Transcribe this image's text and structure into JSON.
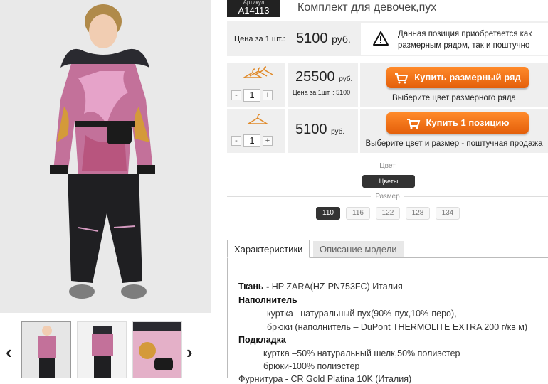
{
  "product": {
    "sku_caption": "Артикул",
    "sku": "A14113",
    "title": "Комплект для девочек,пух"
  },
  "price_row": {
    "label": "Цена за 1 шт.:",
    "value": "5100",
    "currency": "руб."
  },
  "notice": {
    "icon": "warning-icon",
    "text": "Данная позиция приобретается как размерным рядом, так и поштучно"
  },
  "buy_set": {
    "icon": "three-hangers-icon",
    "qty": "1",
    "minus": "-",
    "plus": "+",
    "price": "25500",
    "currency": "руб.",
    "unit_price_text": "Цена за 1шт. : 5100",
    "button_label": "Купить размерный ряд",
    "hint": "Выберите цвет размерного ряда"
  },
  "buy_single": {
    "icon": "hanger-icon",
    "qty": "1",
    "minus": "-",
    "plus": "+",
    "price": "5100",
    "currency": "руб.",
    "button_label": "Купить 1 позицию",
    "hint": "Выберите цвет и размер - поштучная продажа"
  },
  "options": {
    "color_caption": "Цвет",
    "color_chip": "Цветы",
    "size_caption": "Размер",
    "sizes": [
      "110",
      "116",
      "122",
      "128",
      "134"
    ],
    "selected_size": "110"
  },
  "tabs": {
    "characteristics": "Характеристики",
    "description": "Описание модели"
  },
  "specs": {
    "fabric_label": "Ткань -",
    "fabric_value": "HP ZARA(HZ-PN753FC) Италия",
    "filler_label": "Наполнитель",
    "filler_jacket": "куртка –натуральный пух(90%-пух,10%-перо),",
    "filler_pants": "брюки (наполнитель – DuPont THERMOLITE EXTRA 200 г/кв м)",
    "lining_label": "Подкладка",
    "lining_jacket": "куртка –50% натуральный шелк,50% полиэстер",
    "lining_pants": "брюки-100% полиэстер",
    "hardware_partial": "Фурнитура - CR Gold Platina 10K (Италия)"
  },
  "colors": {
    "accent": "#f07418",
    "dark_chip": "#333333",
    "panel_bg": "#efefef"
  }
}
